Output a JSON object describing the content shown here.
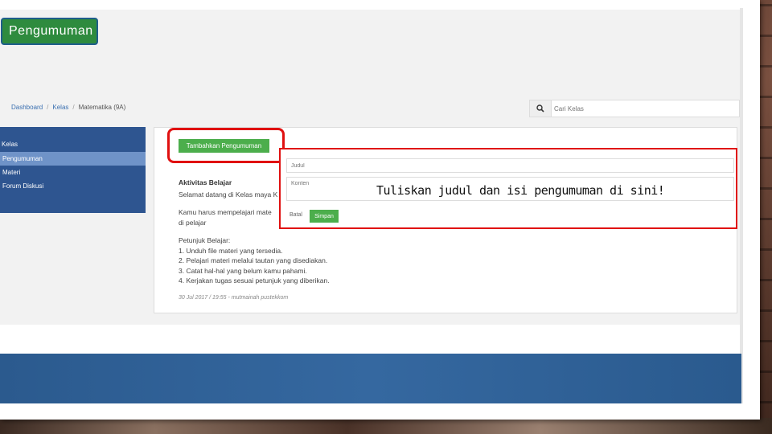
{
  "slide": {
    "title": "Pengumuman",
    "caption": "Tuliskan judul dan isi pengumuman di sini!"
  },
  "breadcrumb": {
    "items": [
      "Dashboard",
      "Kelas",
      "Matematika (9A)"
    ]
  },
  "search": {
    "placeholder": "Cari Kelas",
    "icon": "search-icon"
  },
  "sidebar": {
    "title": "Kelas",
    "items": [
      {
        "label": "Pengumuman",
        "active": true
      },
      {
        "label": "Materi"
      },
      {
        "label": "Forum Diskusi"
      }
    ]
  },
  "main": {
    "add_button": "Tambahkan Pengumuman",
    "heading": "Aktivitas Belajar",
    "welcome": "Selamat datang di Kelas maya K",
    "must_learn": "Kamu harus mempelajari mate",
    "must_learn_2": "di pelajar",
    "guide_title": "Petunjuk Belajar:",
    "steps": [
      "1. Unduh file materi yang tersedia.",
      "2. Pelajari materi melalui tautan yang disediakan.",
      "3. Catat hal-hal yang belum kamu pahami.",
      "4. Kerjakan tugas sesuai petunjuk yang diberikan."
    ],
    "meta": "30 Jul 2017 / 19:55 - mutmainah pustekkom"
  },
  "form": {
    "title_placeholder": "Judul",
    "content_placeholder": "Konten",
    "cancel": "Batal",
    "save": "Simpan"
  },
  "colors": {
    "green": "#4cae4c",
    "sidebar_blue": "#2e5590",
    "highlight_red": "#e01010"
  }
}
